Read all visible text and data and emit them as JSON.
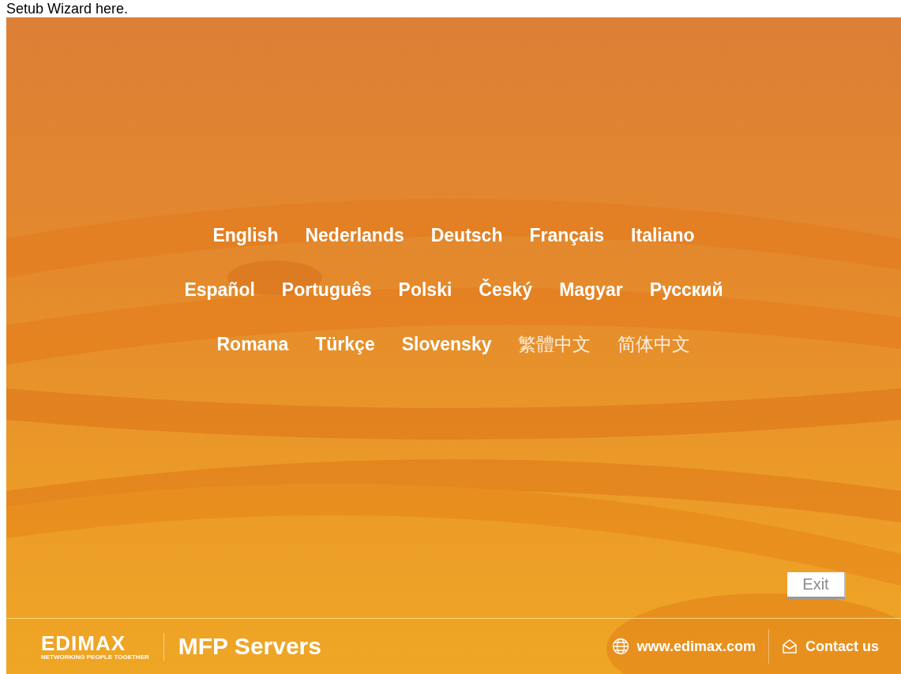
{
  "caption": "Setub Wizard here.",
  "language_rows": [
    {
      "items": [
        {
          "label": "English",
          "kind": "latin"
        },
        {
          "label": "Nederlands",
          "kind": "latin"
        },
        {
          "label": "Deutsch",
          "kind": "latin"
        },
        {
          "label": "Français",
          "kind": "latin"
        },
        {
          "label": "Italiano",
          "kind": "latin"
        }
      ]
    },
    {
      "items": [
        {
          "label": "Español",
          "kind": "latin"
        },
        {
          "label": "Português",
          "kind": "latin"
        },
        {
          "label": "Polski",
          "kind": "latin"
        },
        {
          "label": "Český",
          "kind": "latin"
        },
        {
          "label": "Magyar",
          "kind": "latin"
        },
        {
          "label": "Русский",
          "kind": "latin"
        }
      ]
    },
    {
      "items": [
        {
          "label": "Romana",
          "kind": "latin"
        },
        {
          "label": "Türkçe",
          "kind": "latin"
        },
        {
          "label": "Slovensky",
          "kind": "latin"
        },
        {
          "label": "繁體中文",
          "kind": "cjk"
        },
        {
          "label": "简体中文",
          "kind": "cjk"
        }
      ]
    }
  ],
  "exit_button": "Exit",
  "footer": {
    "logo": "EDIMAX",
    "tagline": "NETWORKING PEOPLE TOGETHER",
    "product": "MFP Servers",
    "website": "www.edimax.com",
    "contact": "Contact us"
  }
}
